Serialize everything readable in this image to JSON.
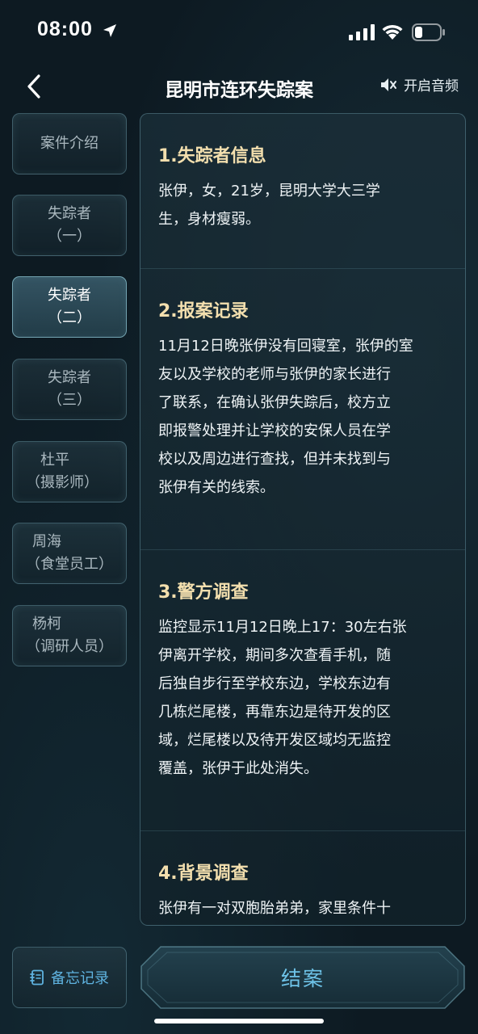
{
  "status_bar": {
    "time": "08:00"
  },
  "nav": {
    "title": "昆明市连环失踪案",
    "audio_label": "开启音频"
  },
  "sidebar": {
    "items": [
      {
        "line1": "案件介绍",
        "line2": ""
      },
      {
        "line1": "失踪者",
        "line2": "（一）"
      },
      {
        "line1": "失踪者",
        "line2": "（二）",
        "active": true
      },
      {
        "line1": "失踪者",
        "line2": "（三）"
      },
      {
        "line1": "杜平",
        "line2": "（摄影师）"
      },
      {
        "line1": "周海",
        "line2": "（食堂员工）"
      },
      {
        "line1": "杨柯",
        "line2": "（调研人员）"
      }
    ]
  },
  "sections": [
    {
      "heading": "1.失踪者信息",
      "lines": [
        "张伊，女，21岁，昆明大学大三学",
        "生，身材瘦弱。"
      ]
    },
    {
      "heading": "2.报案记录",
      "lines": [
        "11月12日晚张伊没有回寝室，张伊的室",
        "友以及学校的老师与张伊的家长进行",
        "了联系，在确认张伊失踪后，校方立",
        "即报警处理并让学校的安保人员在学",
        "校以及周边进行查找，但并未找到与",
        "张伊有关的线索。"
      ]
    },
    {
      "heading": "3.警方调查",
      "lines": [
        "监控显示11月12日晚上17：30左右张",
        "伊离开学校，期间多次查看手机，随",
        "后独自步行至学校东边，学校东边有",
        "几栋烂尾楼，再靠东边是待开发的区",
        "域，烂尾楼以及待开发区域均无监控",
        "覆盖，张伊于此处消失。"
      ]
    },
    {
      "heading": "4.背景调查",
      "lines": [
        "张伊有一对双胞胎弟弟，家里条件十"
      ]
    }
  ],
  "bottom": {
    "memo_label": "备忘记录",
    "close_case_label": "结案"
  },
  "colors": {
    "accent": "#6ec3e8",
    "heading": "#f3dfae",
    "background": "#0d1a22"
  },
  "icons": [
    "location-arrow-icon",
    "signal-icon",
    "wifi-icon",
    "battery-icon",
    "back-chevron-icon",
    "speaker-muted-icon",
    "memo-icon"
  ]
}
